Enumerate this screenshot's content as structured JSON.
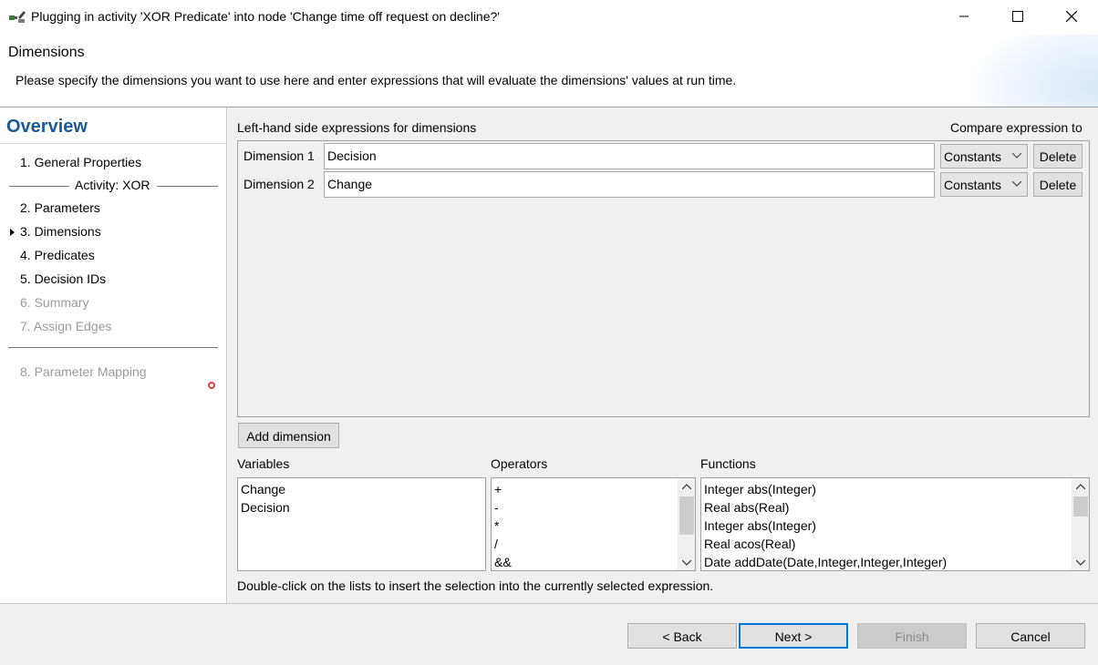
{
  "window": {
    "title": "Plugging in activity 'XOR Predicate' into node 'Change time off request on decline?'"
  },
  "banner": {
    "heading": "Dimensions",
    "description": "Please specify the dimensions you want to use here and enter expressions that will evaluate the dimensions' values at run time."
  },
  "nav": {
    "title": "Overview",
    "items": [
      {
        "label": "1. General Properties"
      },
      {
        "label": "2. Parameters"
      },
      {
        "label": "3. Dimensions"
      },
      {
        "label": "4. Predicates"
      },
      {
        "label": "5. Decision IDs"
      },
      {
        "label": "6. Summary"
      },
      {
        "label": "7. Assign Edges"
      },
      {
        "label": "8. Parameter Mapping"
      }
    ],
    "group_label": "Activity: XOR"
  },
  "main": {
    "lhs_label": "Left-hand side expressions for dimensions",
    "compare_label": "Compare expression to",
    "dimensions": [
      {
        "label": "Dimension 1",
        "value": "Decision",
        "compare": "Constants",
        "delete": "Delete"
      },
      {
        "label": "Dimension 2",
        "value": "Change",
        "compare": "Constants",
        "delete": "Delete"
      }
    ],
    "add_dimension": "Add dimension",
    "variables": {
      "label": "Variables",
      "items": [
        "Change",
        "Decision"
      ]
    },
    "operators": {
      "label": "Operators",
      "items": [
        "+",
        "-",
        "*",
        "/",
        "&&"
      ]
    },
    "functions": {
      "label": "Functions",
      "items": [
        "Integer abs(Integer)",
        "Real abs(Real)",
        "Integer abs(Integer)",
        "Real acos(Real)",
        "Date addDate(Date,Integer,Integer,Integer)"
      ]
    },
    "hint": "Double-click on the lists to insert the selection into the currently selected expression."
  },
  "buttons": {
    "back": "< Back",
    "next": "Next >",
    "finish": "Finish",
    "cancel": "Cancel"
  },
  "colors": {
    "accent": "#0078d7",
    "overview_title": "#1a5a96",
    "error": "#e04040"
  }
}
